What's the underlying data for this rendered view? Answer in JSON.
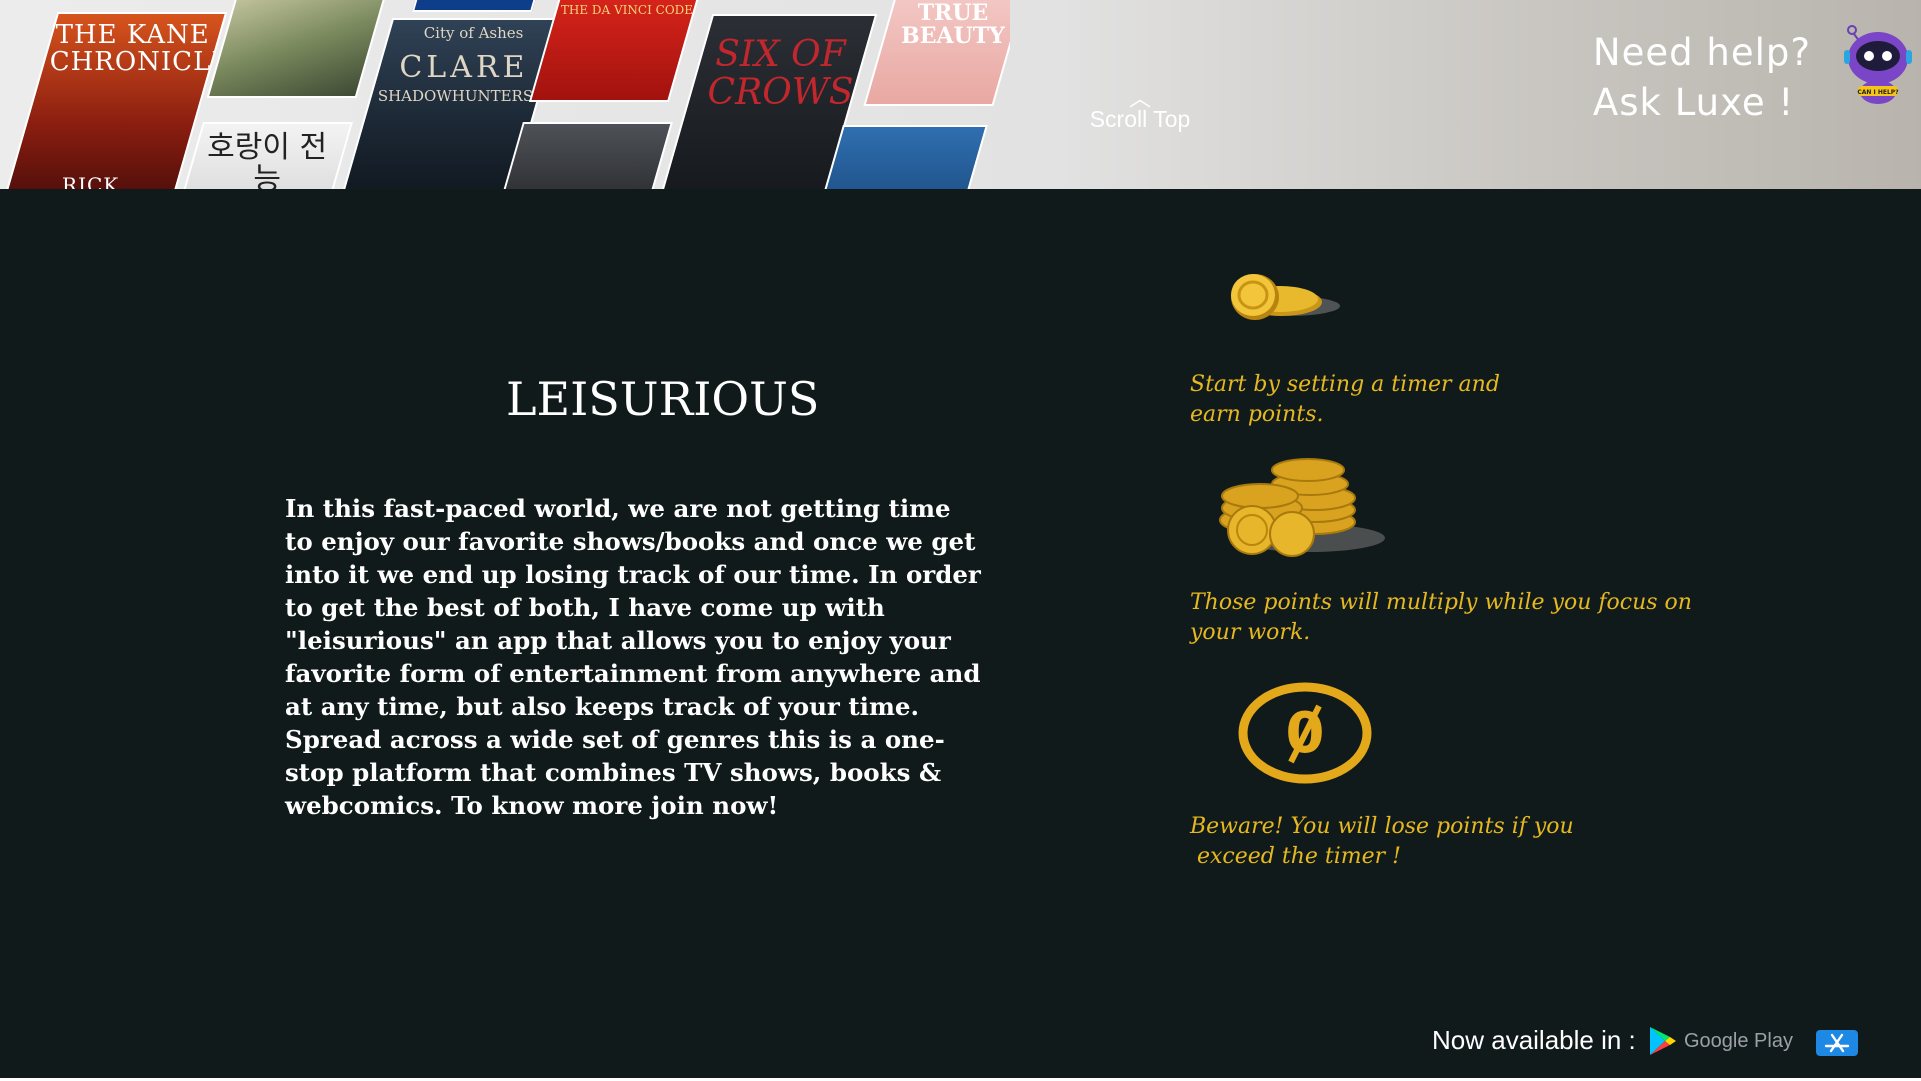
{
  "banner": {
    "covers": [
      {
        "title": "THE KANE CHRONICLES",
        "sub": "RICK RIORDAN"
      },
      {
        "title": "",
        "sub": ""
      },
      {
        "title": "호랑이 전능",
        "sub": ""
      },
      {
        "title": "City of Ashes",
        "big": "CLARE",
        "sub": "SHADOWHUNTERS"
      },
      {
        "title": "",
        "sub": ""
      },
      {
        "title": "THE DA VINCI CODE",
        "sub": ""
      },
      {
        "title": "",
        "sub": ""
      },
      {
        "title": "SIX OF CROWS",
        "sub": ""
      },
      {
        "title": "TRUE BEAUTY",
        "sub": ""
      },
      {
        "title": "",
        "sub": ""
      }
    ],
    "scroll_top": "Scroll Top",
    "help_line1": "Need help?",
    "help_line2": "Ask Luxe !",
    "bot_badge": "CAN I HELP?"
  },
  "main": {
    "title": "LEISURIOUS",
    "description": "In this fast-paced world, we are not getting time to enjoy our favorite shows/books and once we get into it we end up losing track of our time. In order to get the best of both, I have come up with \"leisurious\" an app that allows you to enjoy your favorite form of entertainment from anywhere and at any time, but also keeps track of your time. Spread across a wide set of genres this is a one-stop platform that combines TV shows, books & webcomics. To know more join now!"
  },
  "steps": [
    {
      "icon": "single-coin-icon",
      "text_line1": "Start by setting a timer and",
      "text_line2": "earn points."
    },
    {
      "icon": "coin-stack-icon",
      "text_line1": "Those points will multiply while you focus on",
      "text_line2": "your work."
    },
    {
      "icon": "zero-points-icon",
      "zero": "0",
      "text_line1": "Beware! You will lose points if you",
      "text_line2": " exceed the timer !"
    }
  ],
  "footer": {
    "available_label": "Now available in :",
    "google_play": "Google Play"
  },
  "colors": {
    "background": "#111a1a",
    "accent": "#e6b820",
    "text": "#ffffff"
  }
}
